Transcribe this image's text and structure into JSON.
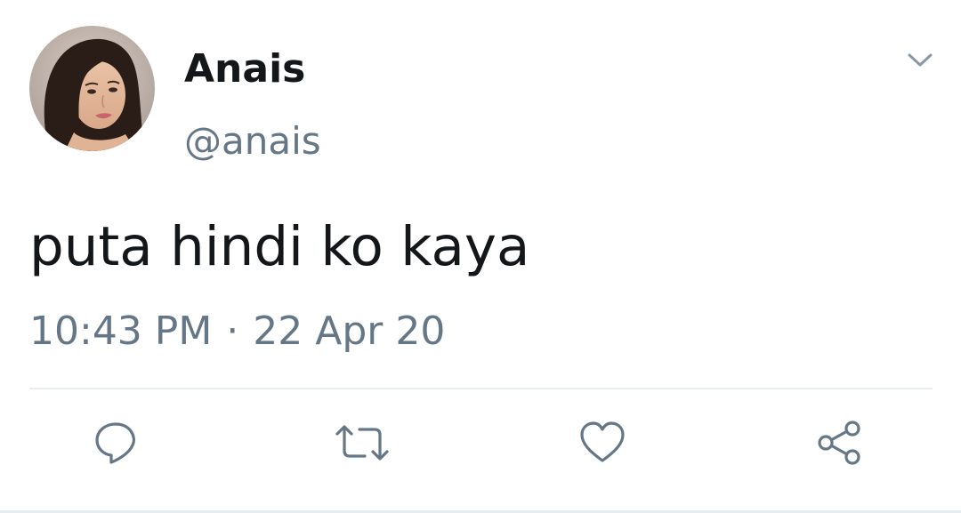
{
  "tweet": {
    "display_name": "Anais",
    "handle": "@anais",
    "text": "puta hindi ko kaya",
    "time": "10:43 PM",
    "separator": "·",
    "date": "22 Apr 20"
  },
  "icons": {
    "avatar": "profile-photo",
    "caret": "chevron-down-icon",
    "reply": "reply-icon",
    "retweet": "retweet-icon",
    "like": "heart-icon",
    "share": "share-icon"
  },
  "colors": {
    "primary_text": "#14171a",
    "secondary_text": "#657786",
    "divider": "#e6ecf0",
    "icon": "#657786"
  }
}
